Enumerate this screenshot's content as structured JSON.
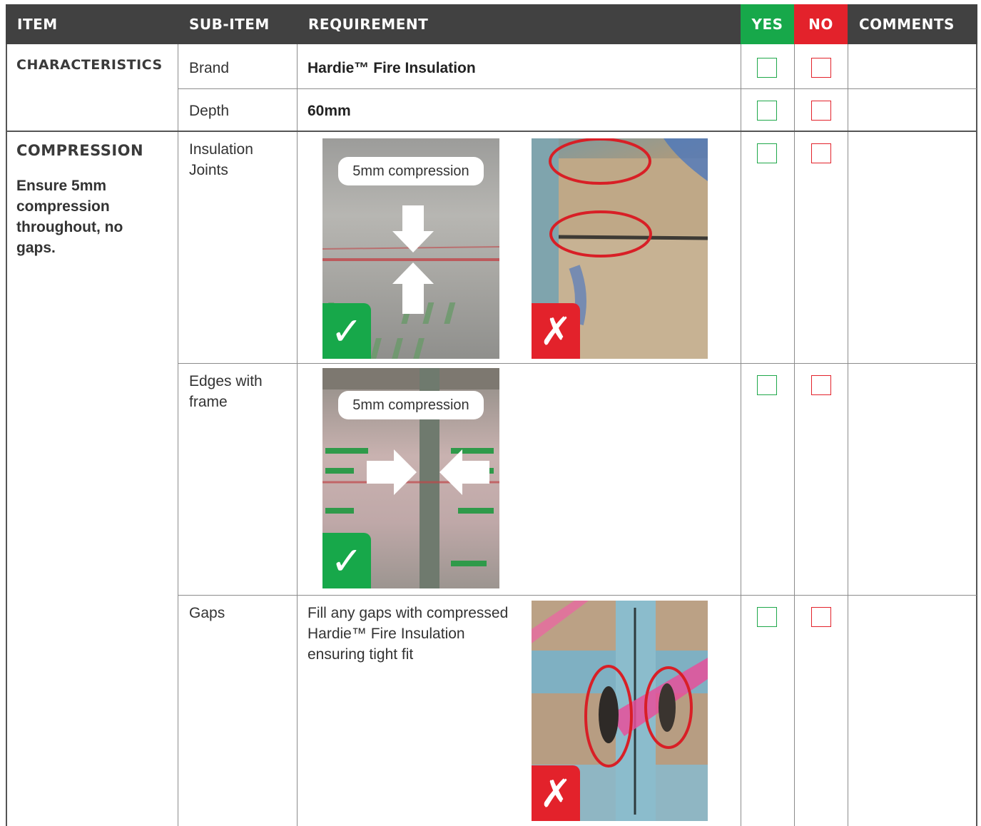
{
  "header": {
    "item": "ITEM",
    "sub_item": "SUB-ITEM",
    "requirement": "REQUIREMENT",
    "yes": "YES",
    "no": "NO",
    "comments": "COMMENTS"
  },
  "characteristics": {
    "item": "CHARACTERISTICS",
    "rows": [
      {
        "sub_item": "Brand",
        "requirement": "Hardie™ Fire Insulation"
      },
      {
        "sub_item": "Depth",
        "requirement": "60mm"
      }
    ]
  },
  "compression": {
    "item": "COMPRESSION",
    "note": "Ensure 5mm compression throughout, no gaps.",
    "rows": [
      {
        "sub_item": "Insulation Joints",
        "callout": "5mm compression",
        "good_mark": "✓",
        "bad_mark": "✗"
      },
      {
        "sub_item": "Edges with frame",
        "callout": "5mm compression",
        "good_mark": "✓"
      },
      {
        "sub_item": "Gaps",
        "requirement": "Fill any gaps with compressed Hardie™ Fire Insulation ensuring tight fit",
        "bad_mark": "✗"
      }
    ]
  },
  "colors": {
    "header_bg": "#414141",
    "yes": "#17a84a",
    "no": "#e3222b"
  }
}
